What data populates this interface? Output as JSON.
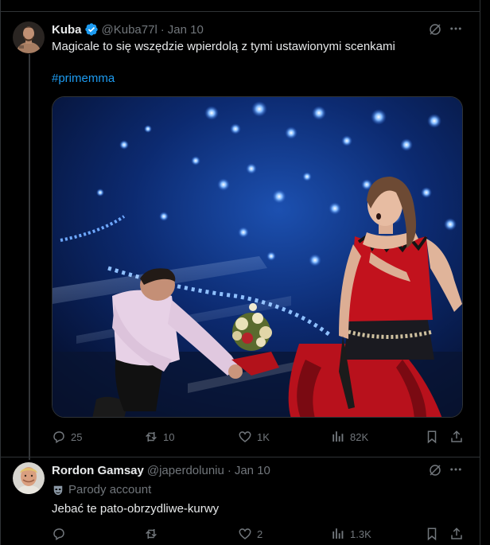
{
  "tweets": [
    {
      "author_name": "Kuba",
      "handle": "@Kuba77l",
      "separator": "·",
      "date": "Jan 10",
      "text": "Magicale to się wszędzie wpierdolą z tymi ustawionymi scenkami",
      "hashtag": "#primemma",
      "verified": true,
      "stats": {
        "replies": "25",
        "retweets": "10",
        "likes": "1K",
        "views": "82K"
      }
    },
    {
      "author_name": "Rordon Gamsay",
      "handle": "@japerdoluniu",
      "separator": "·",
      "date": "Jan 10",
      "parody_label": "Parody account",
      "text": "Jebać te pato-obrzydliwe-kurwy",
      "stats": {
        "replies": "",
        "retweets": "",
        "likes": "2",
        "views": "1.3K"
      }
    }
  ],
  "colors": {
    "background": "#000000",
    "text": "#e7e9ea",
    "muted": "#71767b",
    "accent": "#1d9bf0",
    "divider": "#2f3336"
  },
  "icons": [
    "grok-icon",
    "more-icon",
    "reply-icon",
    "retweet-icon",
    "like-icon",
    "views-icon",
    "bookmark-icon",
    "share-icon"
  ]
}
